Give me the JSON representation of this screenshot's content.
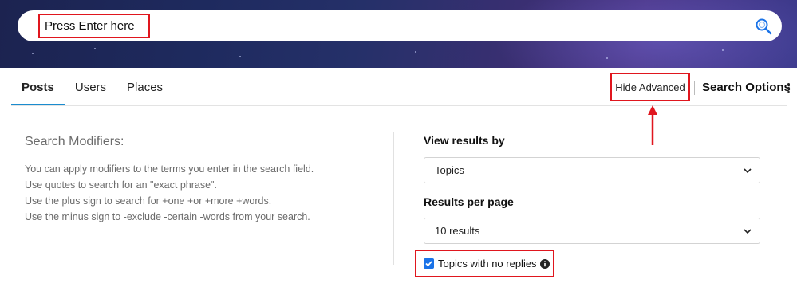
{
  "search": {
    "value": "Press Enter here",
    "icon": "search-icon"
  },
  "tabs": [
    {
      "label": "Posts",
      "active": true
    },
    {
      "label": "Users",
      "active": false
    },
    {
      "label": "Places",
      "active": false
    }
  ],
  "toolbar": {
    "hide_advanced_label": "Hide Advanced",
    "search_options_label": "Search Options"
  },
  "modifiers": {
    "title": "Search Modifiers:",
    "lines": [
      "You can apply modifiers to the terms you enter in the search field.",
      "Use quotes to search for an \"exact phrase\".",
      "Use the plus sign to search for +one +or +more +words.",
      "Use the minus sign to -exclude -certain -words from your search."
    ]
  },
  "view_results": {
    "label": "View results by",
    "selected": "Topics"
  },
  "results_per_page": {
    "label": "Results per page",
    "selected": "10 results"
  },
  "no_replies": {
    "label": "Topics with no replies",
    "checked": true
  },
  "colors": {
    "highlight": "#e0161e",
    "accent": "#1a8ccf",
    "checkbox": "#1a73e8"
  }
}
